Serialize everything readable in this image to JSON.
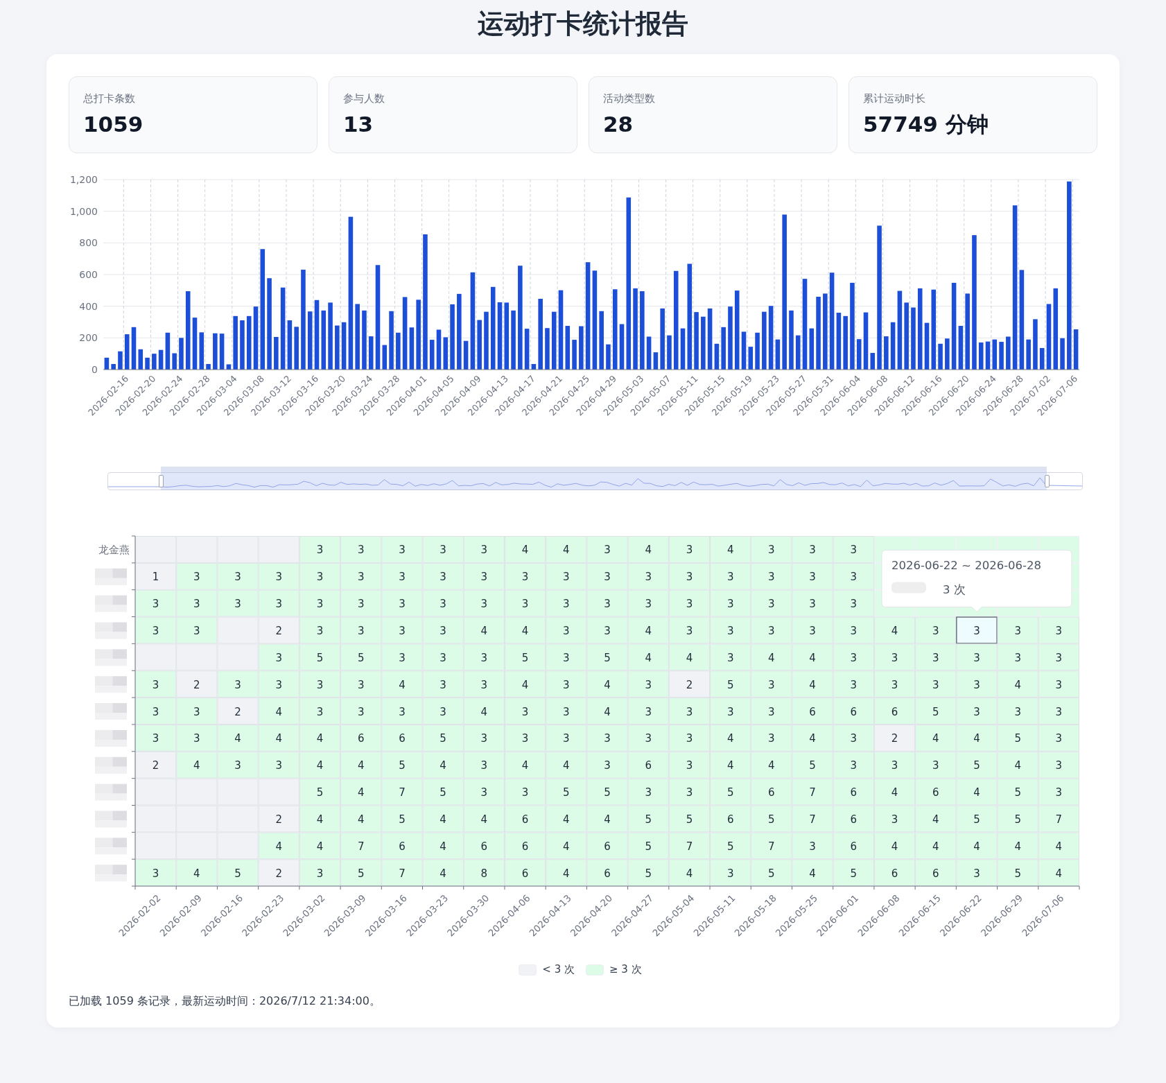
{
  "title": "运动打卡统计报告",
  "stats": [
    {
      "label": "总打卡条数",
      "value": "1059"
    },
    {
      "label": "参与人数",
      "value": "13"
    },
    {
      "label": "活动类型数",
      "value": "28"
    },
    {
      "label": "累计运动时长",
      "value": "57749 分钟"
    }
  ],
  "daily_chart": {
    "chart_data": {
      "type": "bar",
      "grid": true,
      "ylim": [
        0,
        1200
      ],
      "yticks": [
        {
          "value": 0,
          "label": "0"
        },
        {
          "value": 200,
          "label": "200"
        },
        {
          "value": 400,
          "label": "400"
        },
        {
          "value": 600,
          "label": "600"
        },
        {
          "value": 800,
          "label": "800"
        },
        {
          "value": 1000,
          "label": "1,000"
        },
        {
          "value": 1200,
          "label": "1,200"
        }
      ],
      "categories": [
        null,
        null,
        null,
        "2026-02-16",
        null,
        null,
        null,
        "2026-02-20",
        null,
        null,
        null,
        "2026-02-24",
        null,
        null,
        null,
        "2026-02-28",
        null,
        null,
        null,
        "2026-03-04",
        null,
        null,
        null,
        "2026-03-08",
        null,
        null,
        null,
        "2026-03-12",
        null,
        null,
        null,
        "2026-03-16",
        null,
        null,
        null,
        "2026-03-20",
        null,
        null,
        null,
        "2026-03-24",
        null,
        null,
        null,
        "2026-03-28",
        null,
        null,
        null,
        "2026-04-01",
        null,
        null,
        null,
        "2026-04-05",
        null,
        null,
        null,
        "2026-04-09",
        null,
        null,
        null,
        "2026-04-13",
        null,
        null,
        null,
        "2026-04-17",
        null,
        null,
        null,
        "2026-04-21",
        null,
        null,
        null,
        "2026-04-25",
        null,
        null,
        null,
        "2026-04-29",
        null,
        null,
        null,
        "2026-05-03",
        null,
        null,
        null,
        "2026-05-07",
        null,
        null,
        null,
        "2026-05-11",
        null,
        null,
        null,
        "2026-05-15",
        null,
        null,
        null,
        "2026-05-19",
        null,
        null,
        null,
        "2026-05-23",
        null,
        null,
        null,
        "2026-05-27",
        null,
        null,
        null,
        "2026-05-31",
        null,
        null,
        null,
        "2026-06-04",
        null,
        null,
        null,
        "2026-06-08",
        null,
        null,
        null,
        "2026-06-12",
        null,
        null,
        null,
        "2026-06-16",
        null,
        null,
        null,
        "2026-06-20",
        null,
        null,
        null,
        "2026-06-24",
        null,
        null,
        null,
        "2026-06-28",
        null,
        null,
        null,
        "2026-07-02",
        null,
        null,
        null,
        "2026-07-06"
      ],
      "series": [
        {
          "color": "#1d4ed8",
          "values": [
            75,
            35,
            115,
            223,
            268,
            128,
            75,
            100,
            124,
            233,
            103,
            200,
            495,
            328,
            235,
            35,
            229,
            227,
            33,
            338,
            311,
            338,
            398,
            761,
            577,
            206,
            518,
            311,
            270,
            631,
            367,
            439,
            373,
            423,
            278,
            299,
            965,
            414,
            373,
            210,
            660,
            155,
            369,
            233,
            458,
            266,
            441,
            854,
            188,
            252,
            204,
            412,
            478,
            181,
            614,
            313,
            365,
            522,
            425,
            423,
            373,
            656,
            258,
            35,
            447,
            262,
            365,
            501,
            276,
            188,
            274,
            678,
            625,
            369,
            159,
            507,
            287,
            1087,
            513,
            495,
            208,
            109,
            386,
            216,
            623,
            260,
            668,
            363,
            334,
            386,
            163,
            268,
            398,
            499,
            239,
            144,
            233,
            365,
            402,
            190,
            979,
            373,
            216,
            573,
            260,
            460,
            480,
            612,
            359,
            338,
            548,
            192,
            361,
            105,
            909,
            210,
            299,
            497,
            423,
            392,
            513,
            295,
            505,
            163,
            196,
            548,
            276,
            480,
            849,
            171,
            177,
            190,
            175,
            208,
            1037,
            629,
            190,
            318,
            136,
            414,
            513,
            198,
            1188,
            254
          ]
        }
      ]
    }
  },
  "heatmap": {
    "x_axis_labels": [
      "2026-02-02",
      "2026-02-09",
      "2026-02-16",
      "2026-02-23",
      "2026-03-02",
      "2026-03-09",
      "2026-03-16",
      "2026-03-23",
      "2026-03-30",
      "2026-04-06",
      "2026-04-13",
      "2026-04-20",
      "2026-04-27",
      "2026-05-04",
      "2026-05-11",
      "2026-05-18",
      "2026-05-25",
      "2026-06-01",
      "2026-06-08",
      "2026-06-15",
      "2026-06-22",
      "2026-06-29",
      "2026-07-06"
    ],
    "rows": [
      {
        "name": "龙金燕",
        "cells": [
          null,
          null,
          null,
          null,
          "3",
          "3",
          "3",
          "3",
          "3",
          "4",
          "4",
          "3",
          "4",
          "3",
          "4",
          "3",
          "3",
          "3"
        ]
      },
      {
        "name_blurred": true,
        "cells": [
          "1",
          "3",
          "3",
          "3",
          "3",
          "3",
          "3",
          "3",
          "3",
          "3",
          "3",
          "3",
          "3",
          "3",
          "3",
          "3",
          "3",
          "3"
        ]
      },
      {
        "name_blurred": true,
        "cells": [
          "3",
          "3",
          "3",
          "3",
          "3",
          "3",
          "3",
          "3",
          "3",
          "3",
          "3",
          "3",
          "3",
          "3",
          "3",
          "3",
          "3",
          "3"
        ]
      },
      {
        "name_blurred": true,
        "cells": [
          "3",
          "3",
          null,
          "2",
          "3",
          "3",
          "3",
          "3",
          "4",
          "4",
          "3",
          "3",
          "4",
          "3",
          "3",
          "3",
          "3",
          "3",
          "4",
          "3",
          {
            "value": "3",
            "hovered": true
          },
          "3",
          "3"
        ]
      },
      {
        "name_blurred": true,
        "cells": [
          null,
          null,
          null,
          "3",
          "5",
          "5",
          "3",
          "3",
          "3",
          "5",
          "3",
          "5",
          "4",
          "4",
          "3",
          "4",
          "4",
          "3",
          "3",
          "3",
          "3",
          "3",
          "3"
        ]
      },
      {
        "name_blurred": true,
        "cells": [
          "3",
          "2",
          "3",
          "3",
          "3",
          "3",
          "4",
          "3",
          "3",
          "4",
          "3",
          "4",
          "3",
          "2",
          "5",
          "3",
          "4",
          "3",
          "3",
          "3",
          "3",
          "4",
          "3"
        ]
      },
      {
        "name_blurred": true,
        "cells": [
          "3",
          "3",
          "2",
          "4",
          "3",
          "3",
          "3",
          "3",
          "4",
          "3",
          "3",
          "4",
          "3",
          "3",
          "3",
          "3",
          "6",
          "6",
          "6",
          "5",
          "3",
          "3",
          "3"
        ]
      },
      {
        "name_blurred": true,
        "cells": [
          "3",
          "3",
          "4",
          "4",
          "4",
          "6",
          "6",
          "5",
          "3",
          "3",
          "3",
          "3",
          "3",
          "3",
          "4",
          "3",
          "4",
          "3",
          "2",
          "4",
          "4",
          "5",
          "3"
        ]
      },
      {
        "name_blurred": true,
        "cells": [
          "2",
          "4",
          "3",
          "3",
          "4",
          "4",
          "5",
          "4",
          "3",
          "4",
          "4",
          "3",
          "6",
          "3",
          "4",
          "4",
          "5",
          "3",
          "3",
          "3",
          "5",
          "4",
          "3"
        ]
      },
      {
        "name_blurred": true,
        "cells": [
          null,
          null,
          null,
          null,
          "5",
          "4",
          "7",
          "5",
          "3",
          "3",
          "5",
          "5",
          "3",
          "3",
          "5",
          "6",
          "7",
          "6",
          "4",
          "6",
          "4",
          "5",
          "3"
        ]
      },
      {
        "name_blurred": true,
        "cells": [
          null,
          null,
          null,
          "2",
          "4",
          "4",
          "5",
          "4",
          "4",
          "6",
          "4",
          "4",
          "5",
          "5",
          "6",
          "5",
          "7",
          "6",
          "3",
          "4",
          "5",
          "5",
          "7"
        ]
      },
      {
        "name_blurred": true,
        "cells": [
          null,
          null,
          null,
          "4",
          "4",
          "7",
          "6",
          "4",
          "6",
          "6",
          "4",
          "6",
          "5",
          "7",
          "5",
          "7",
          "3",
          "6",
          "4",
          "4",
          "4",
          "4",
          "4"
        ]
      },
      {
        "name_blurred": true,
        "cells": [
          "3",
          "4",
          "5",
          "2",
          "3",
          "5",
          "7",
          "4",
          "8",
          "6",
          "4",
          "6",
          "5",
          "4",
          "3",
          "5",
          "4",
          "5",
          "6",
          "6",
          "3",
          "5",
          "4"
        ]
      }
    ],
    "tooltip": {
      "title": "2026-06-22 ~ 2026-06-28",
      "name_blurred": true,
      "value": "3 次"
    },
    "legend": [
      {
        "label": "< 3 次",
        "color": "#f1f2f5"
      },
      {
        "label": "≥ 3 次",
        "color": "#dcfce7"
      }
    ]
  },
  "range_slider": {
    "start": {
      "level": 0.055
    },
    "end": {
      "level": 0.963
    }
  },
  "footer": "已加载 1059 条记录，最新运动时间：2026/7/12 21:34:00。"
}
